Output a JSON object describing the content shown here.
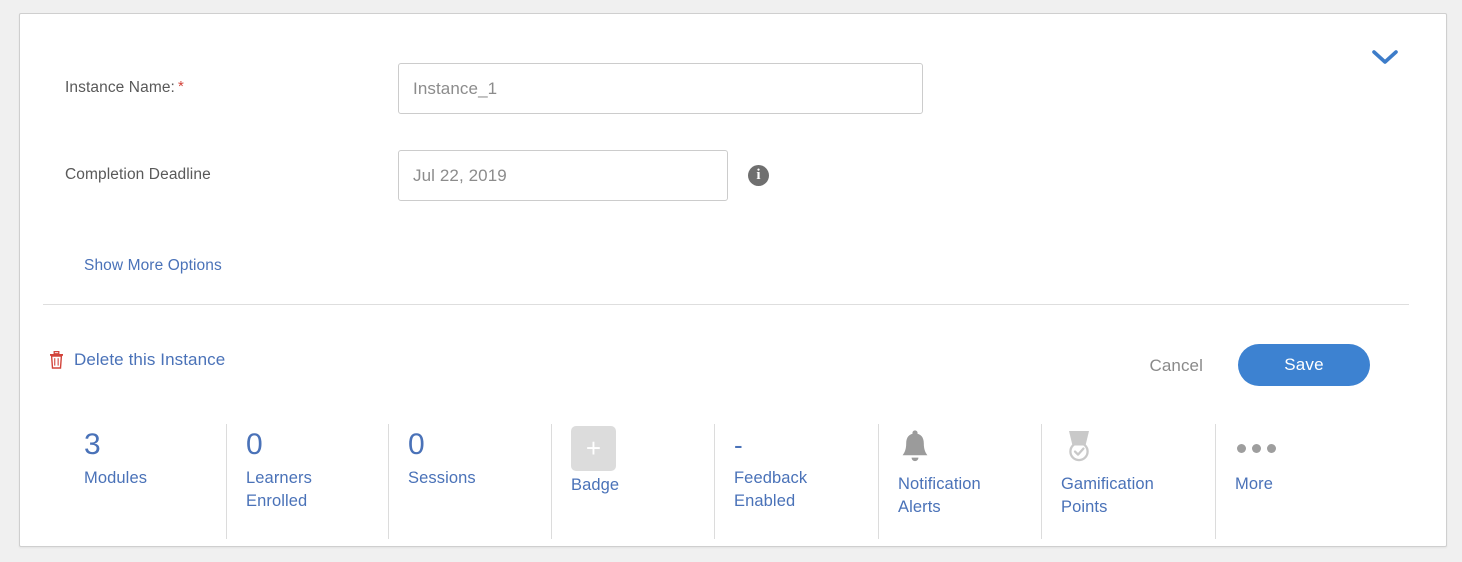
{
  "card": {
    "collapse_icon": "chevron-down-icon"
  },
  "form": {
    "instance_name": {
      "label": "Instance Name:",
      "required_marker": "*",
      "value": "Instance_1",
      "placeholder": "Instance_1"
    },
    "completion_deadline": {
      "label": "Completion Deadline",
      "value": "Jul 22, 2019",
      "placeholder": "Jul 22, 2019",
      "info_icon": "info-icon",
      "info_glyph": "i"
    },
    "show_more_options": "Show More Options"
  },
  "actions": {
    "delete_label": "Delete this Instance",
    "delete_icon": "trash-icon",
    "cancel_label": "Cancel",
    "save_label": "Save"
  },
  "stats": [
    {
      "value": "3",
      "label": "Modules",
      "kind": "number"
    },
    {
      "value": "0",
      "label": "Learners Enrolled",
      "kind": "number"
    },
    {
      "value": "0",
      "label": "Sessions",
      "kind": "number"
    },
    {
      "value": "+",
      "label": "Badge",
      "kind": "badge"
    },
    {
      "value": "-",
      "label": "Feedback Enabled",
      "kind": "dash"
    },
    {
      "value": "",
      "label": "Notification Alerts",
      "kind": "bell"
    },
    {
      "value": "",
      "label": "Gamification Points",
      "kind": "medal"
    },
    {
      "value": "",
      "label": "More",
      "kind": "dots"
    }
  ],
  "colors": {
    "link_blue": "#4a72b8",
    "button_blue": "#3d82d1",
    "required_red": "#d2433a",
    "trash_red": "#d2433a",
    "muted_gray": "#8a8a8a",
    "icon_gray": "#9e9e9e",
    "page_background": "#f0f0f0",
    "card_background": "#ffffff"
  }
}
